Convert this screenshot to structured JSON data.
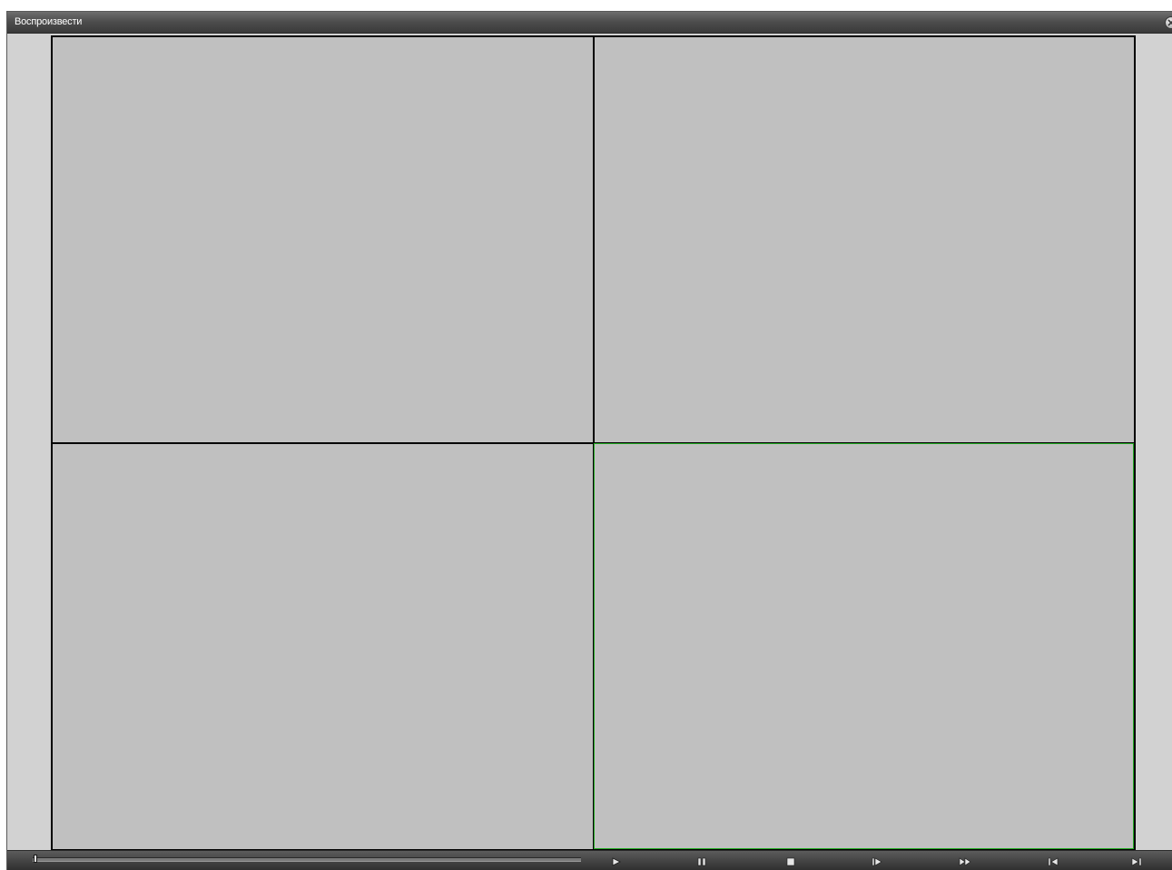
{
  "window": {
    "title": "Воспроизвести"
  },
  "grid": {
    "cells": [
      "channel-1",
      "channel-2",
      "channel-3",
      "channel-4"
    ],
    "selected_cell": 4,
    "selection_color": "#22aa22"
  },
  "controls": {
    "progress": 0,
    "buttons": [
      {
        "name": "play-button",
        "icon": "play-icon"
      },
      {
        "name": "pause-button",
        "icon": "pause-icon"
      },
      {
        "name": "stop-button",
        "icon": "stop-icon"
      },
      {
        "name": "step-forward-button",
        "icon": "step-forward-icon"
      },
      {
        "name": "fast-forward-button",
        "icon": "fast-forward-icon"
      },
      {
        "name": "previous-button",
        "icon": "skip-back-icon"
      },
      {
        "name": "next-button",
        "icon": "skip-forward-icon"
      }
    ]
  },
  "colors": {
    "titlebar": "#4e4e4e",
    "window_bg": "#d2d2d2",
    "video_bg": "#c0c0c0",
    "grid_border": "#000000"
  }
}
